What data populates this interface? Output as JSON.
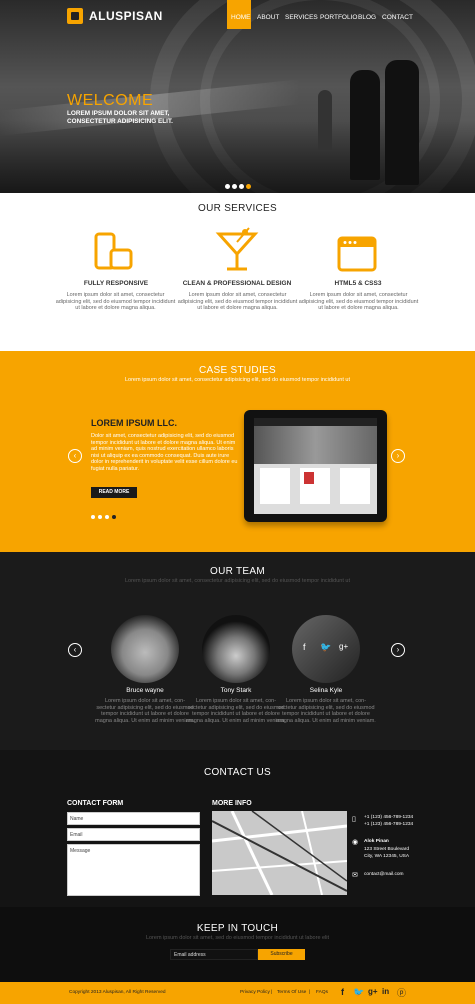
{
  "brand": {
    "name": "ALUSPISAN"
  },
  "nav": {
    "items": [
      "HOME",
      "ABOUT",
      "SERVICES",
      "PORTFOLIO",
      "BLOG",
      "CONTACT"
    ]
  },
  "hero": {
    "title": "WELCOME",
    "subtitle_line1": "LOREM IPSUM DOLOR SIT AMET,",
    "subtitle_line2": "CONSECTETUR ADIPISICING ELIT."
  },
  "services": {
    "heading": "OUR SERVICES",
    "items": [
      {
        "icon": "mobile-tablet-icon",
        "title": "FULLY RESPONSIVE",
        "text": "Lorem ipsum dolor sit amet, consectetur adipisicing elit, sed do eiusmod tempor incididunt ut labore et dolore magna aliqua."
      },
      {
        "icon": "cocktail-icon",
        "title": "CLEAN & PROFESSIONAL DESIGN",
        "text": "Lorem ipsum dolor sit amet, consectetur adipisicing elit, sed do eiusmod tempor incididunt ut labore et dolore magna aliqua."
      },
      {
        "icon": "browser-window-icon",
        "title": "HTML5 & CSS3",
        "text": "Lorem ipsum dolor sit amet, consectetur adipisicing elit, sed do eiusmod tempor incididunt ut labore et dolore magna aliqua."
      }
    ]
  },
  "cases": {
    "heading": "CASE STUDIES",
    "subheading": "Lorem ipsum dolor sit amet, consectetur adipisicing elit, sed do eiusmod tempor incididunt ut",
    "title": "LOREM IPSUM LLC.",
    "text": "Dolor sit amet, consectetur adipisicing elit, sed do eiusmod tempor incididunt ut labore et dolore magna aliqua. Ut enim ad minim veniam, quis nostrud exercitation ullamco laboris nisi ut aliquip ex ea commodo consequat. Duis aute irure dolor in reprehenderit in voluptate velit esse cillum dolore eu fugiat nulla pariatur.",
    "button": "READ MORE"
  },
  "team": {
    "heading": "OUR TEAM",
    "subheading": "Lorem ipsum dolor sit amet, consectetur adipisicing elit, sed do eiusmod tempor incididunt ut",
    "members": [
      {
        "name": "Bruce wayne",
        "text": "Lorem ipsum dolor sit amet, con- sectetur adipisicing elit, sed do eiusmod tempor incididunt ut labore et dolore magna aliqua. Ut enim ad minim veniam."
      },
      {
        "name": "Tony Stark",
        "text": "Lorem ipsum dolor sit amet, con- sectetur adipisicing elit, sed do eiusmod tempor incididunt ut labore et dolore magna aliqua. Ut enim ad minim veniam."
      },
      {
        "name": "Selina Kyle",
        "text": "Lorem ipsum dolor sit amet, con- sectetur adipisicing elit, sed do eiusmod tempor incididunt ut labore et dolore magna aliqua. Ut enim ad minim veniam."
      }
    ]
  },
  "contact": {
    "heading": "CONTACT US",
    "form_heading": "CONTACT FORM",
    "name_placeholder": "Name",
    "email_placeholder": "Email",
    "message_placeholder": "Message",
    "info_heading": "MORE INFO",
    "phone1": "+1 (123) 456-789-1234",
    "phone2": "+1 (123) 456-789-1234",
    "contact_name": "Alok Pinan",
    "address1": "123 Street Boulevard",
    "address2": "City, WA 12345, USA",
    "email": "contact@mail.com"
  },
  "keep": {
    "heading": "KEEP IN TOUCH",
    "subheading": "Lorem ipsum dolor sit amet, sed do eiusmod tempor incididunt ut labore elit",
    "email_placeholder": "Email address",
    "button": "Subscribe"
  },
  "footer": {
    "copyright": "Copyright 2013 Aluspisan, All Right Reserved",
    "links": [
      "Privacy Policy",
      "Terms Of Use",
      "FAQs"
    ]
  },
  "colors": {
    "accent": "#f7a400",
    "dark": "#1b1b1b"
  }
}
